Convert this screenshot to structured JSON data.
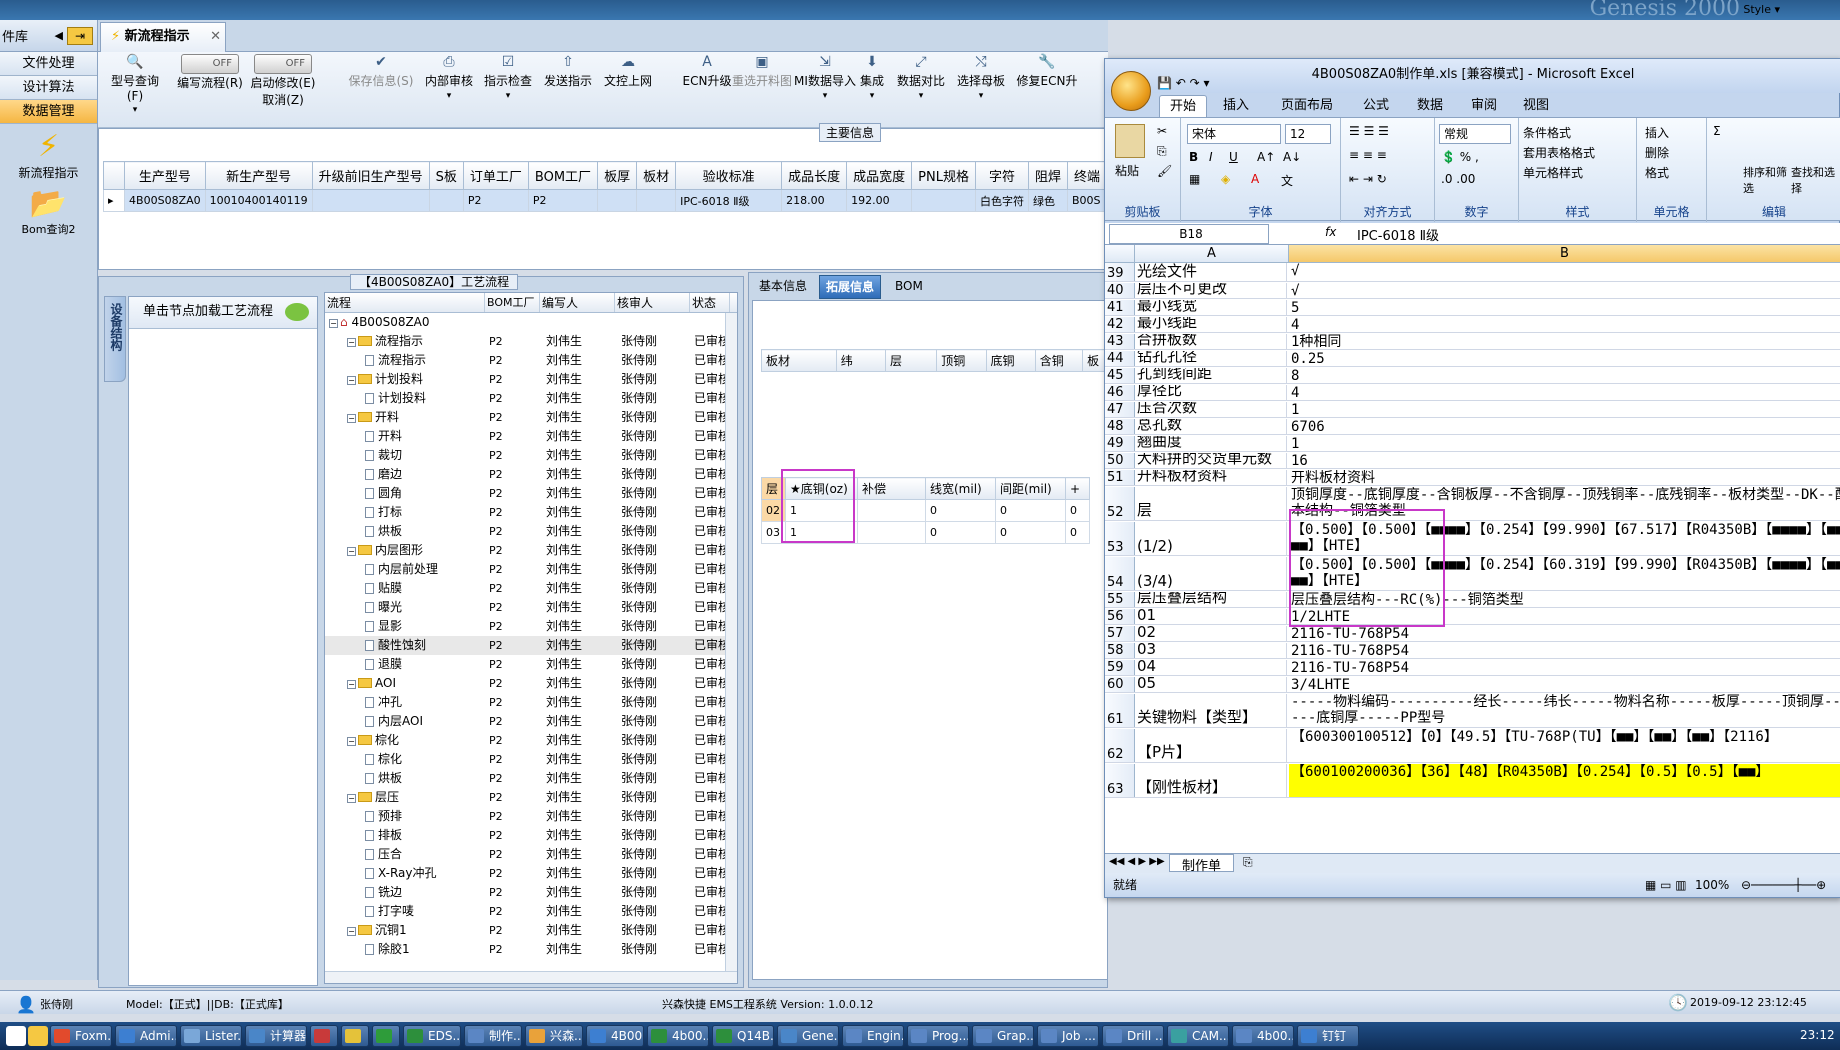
{
  "topbar": {
    "style_label": "Style ▾",
    "bg_text": "Genesis 2000"
  },
  "leftnav": {
    "title": "件库",
    "items": [
      "文件处理",
      "设计算法",
      "数据管理"
    ],
    "apps": [
      "新流程指示",
      "Bom查询2"
    ]
  },
  "tab": {
    "label": "新流程指示"
  },
  "ribbon": {
    "buttons": [
      {
        "label": "型号查询(F)",
        "icon": "search-icon"
      },
      {
        "label": "编写流程(R)",
        "icon": "toggle-off",
        "toggle": "OFF"
      },
      {
        "label": "启动修改(E)",
        "sub": "取消(Z)",
        "icon": "toggle-off",
        "toggle": "OFF"
      },
      {
        "label": "保存信息(S)",
        "icon": "check-icon",
        "disabled": true
      },
      {
        "label": "内部审核",
        "icon": "print-icon"
      },
      {
        "label": "指示检查",
        "icon": "check-icon"
      },
      {
        "label": "发送指示",
        "icon": "upload-icon"
      },
      {
        "label": "文控上网",
        "icon": "cloud-icon"
      },
      {
        "label": "ECN升级",
        "icon": "ecn-icon"
      },
      {
        "label": "重选开料图",
        "icon": "image-icon",
        "disabled": true
      },
      {
        "label": "MI数据导入",
        "icon": "import-icon"
      },
      {
        "label": "集成",
        "icon": "download-icon"
      },
      {
        "label": "数据对比",
        "icon": "compare-icon"
      },
      {
        "label": "选择母板",
        "icon": "shuffle-icon"
      },
      {
        "label": "修复ECN升",
        "icon": "wrench-icon"
      }
    ]
  },
  "maininfo": {
    "caption": "主要信息",
    "headers": [
      "生产型号",
      "新生产型号",
      "升级前旧生产型号",
      "S板",
      "订单工厂",
      "BOM工厂",
      "板厚",
      "板材",
      "验收标准",
      "成品长度",
      "成品宽度",
      "PNL规格",
      "字符",
      "阻焊",
      "终端"
    ],
    "row": [
      "4B00S08ZA0",
      "10010400140119",
      "",
      "",
      "P2",
      "P2",
      "",
      "",
      "IPC-6018 Ⅱ级",
      "218.00",
      "192.00",
      "",
      "白色字符",
      "绿色",
      "B00S"
    ]
  },
  "process": {
    "caption": "【4B00S08ZA0】工艺流程",
    "sidetab": "设备结构",
    "node_hint": "单击节点加载工艺流程",
    "headers": [
      "流程",
      "BOM工厂",
      "编写人",
      "核审人",
      "状态"
    ],
    "rows": [
      {
        "lvl": 0,
        "type": "root",
        "name": "4B00S08ZA0",
        "f": "",
        "w": "",
        "c": "",
        "s": ""
      },
      {
        "lvl": 1,
        "type": "folder",
        "name": "流程指示",
        "f": "P2",
        "w": "刘伟生",
        "c": "张侍刚",
        "s": "已审核"
      },
      {
        "lvl": 2,
        "type": "doc",
        "name": "流程指示",
        "f": "P2",
        "w": "刘伟生",
        "c": "张侍刚",
        "s": "已审核"
      },
      {
        "lvl": 1,
        "type": "folder",
        "name": "计划投料",
        "f": "P2",
        "w": "刘伟生",
        "c": "张侍刚",
        "s": "已审核"
      },
      {
        "lvl": 2,
        "type": "doc",
        "name": "计划投料",
        "f": "P2",
        "w": "刘伟生",
        "c": "张侍刚",
        "s": "已审核"
      },
      {
        "lvl": 1,
        "type": "folder",
        "name": "开料",
        "f": "P2",
        "w": "刘伟生",
        "c": "张侍刚",
        "s": "已审核"
      },
      {
        "lvl": 2,
        "type": "doc",
        "name": "开料",
        "f": "P2",
        "w": "刘伟生",
        "c": "张侍刚",
        "s": "已审核"
      },
      {
        "lvl": 2,
        "type": "doc",
        "name": "裁切",
        "f": "P2",
        "w": "刘伟生",
        "c": "张侍刚",
        "s": "已审核"
      },
      {
        "lvl": 2,
        "type": "doc",
        "name": "磨边",
        "f": "P2",
        "w": "刘伟生",
        "c": "张侍刚",
        "s": "已审核"
      },
      {
        "lvl": 2,
        "type": "doc",
        "name": "圆角",
        "f": "P2",
        "w": "刘伟生",
        "c": "张侍刚",
        "s": "已审核"
      },
      {
        "lvl": 2,
        "type": "doc",
        "name": "打标",
        "f": "P2",
        "w": "刘伟生",
        "c": "张侍刚",
        "s": "已审核"
      },
      {
        "lvl": 2,
        "type": "doc",
        "name": "烘板",
        "f": "P2",
        "w": "刘伟生",
        "c": "张侍刚",
        "s": "已审核"
      },
      {
        "lvl": 1,
        "type": "folder",
        "name": "内层图形",
        "f": "P2",
        "w": "刘伟生",
        "c": "张侍刚",
        "s": "已审核"
      },
      {
        "lvl": 2,
        "type": "doc",
        "name": "内层前处理",
        "f": "P2",
        "w": "刘伟生",
        "c": "张侍刚",
        "s": "已审核"
      },
      {
        "lvl": 2,
        "type": "doc",
        "name": "贴膜",
        "f": "P2",
        "w": "刘伟生",
        "c": "张侍刚",
        "s": "已审核"
      },
      {
        "lvl": 2,
        "type": "doc",
        "name": "曝光",
        "f": "P2",
        "w": "刘伟生",
        "c": "张侍刚",
        "s": "已审核"
      },
      {
        "lvl": 2,
        "type": "doc",
        "name": "显影",
        "f": "P2",
        "w": "刘伟生",
        "c": "张侍刚",
        "s": "已审核"
      },
      {
        "lvl": 2,
        "type": "doc",
        "name": "酸性蚀刻",
        "f": "P2",
        "w": "刘伟生",
        "c": "张侍刚",
        "s": "已审核",
        "sel": true
      },
      {
        "lvl": 2,
        "type": "doc",
        "name": "退膜",
        "f": "P2",
        "w": "刘伟生",
        "c": "张侍刚",
        "s": "已审核"
      },
      {
        "lvl": 1,
        "type": "folder",
        "name": "AOI",
        "f": "P2",
        "w": "刘伟生",
        "c": "张侍刚",
        "s": "已审核"
      },
      {
        "lvl": 2,
        "type": "doc",
        "name": "冲孔",
        "f": "P2",
        "w": "刘伟生",
        "c": "张侍刚",
        "s": "已审核"
      },
      {
        "lvl": 2,
        "type": "doc",
        "name": "内层AOI",
        "f": "P2",
        "w": "刘伟生",
        "c": "张侍刚",
        "s": "已审核"
      },
      {
        "lvl": 1,
        "type": "folder",
        "name": "棕化",
        "f": "P2",
        "w": "刘伟生",
        "c": "张侍刚",
        "s": "已审核"
      },
      {
        "lvl": 2,
        "type": "doc",
        "name": "棕化",
        "f": "P2",
        "w": "刘伟生",
        "c": "张侍刚",
        "s": "已审核"
      },
      {
        "lvl": 2,
        "type": "doc",
        "name": "烘板",
        "f": "P2",
        "w": "刘伟生",
        "c": "张侍刚",
        "s": "已审核"
      },
      {
        "lvl": 1,
        "type": "folder",
        "name": "层压",
        "f": "P2",
        "w": "刘伟生",
        "c": "张侍刚",
        "s": "已审核"
      },
      {
        "lvl": 2,
        "type": "doc",
        "name": "预排",
        "f": "P2",
        "w": "刘伟生",
        "c": "张侍刚",
        "s": "已审核"
      },
      {
        "lvl": 2,
        "type": "doc",
        "name": "排板",
        "f": "P2",
        "w": "刘伟生",
        "c": "张侍刚",
        "s": "已审核"
      },
      {
        "lvl": 2,
        "type": "doc",
        "name": "压合",
        "f": "P2",
        "w": "刘伟生",
        "c": "张侍刚",
        "s": "已审核"
      },
      {
        "lvl": 2,
        "type": "doc",
        "name": "X-Ray冲孔",
        "f": "P2",
        "w": "刘伟生",
        "c": "张侍刚",
        "s": "已审核"
      },
      {
        "lvl": 2,
        "type": "doc",
        "name": "铣边",
        "f": "P2",
        "w": "刘伟生",
        "c": "张侍刚",
        "s": "已审核"
      },
      {
        "lvl": 2,
        "type": "doc",
        "name": "打字唛",
        "f": "P2",
        "w": "刘伟生",
        "c": "张侍刚",
        "s": "已审核"
      },
      {
        "lvl": 1,
        "type": "folder",
        "name": "沉铜1",
        "f": "P2",
        "w": "刘伟生",
        "c": "张侍刚",
        "s": "已审核"
      },
      {
        "lvl": 2,
        "type": "doc",
        "name": "除胶1",
        "f": "P2",
        "w": "刘伟生",
        "c": "张侍刚",
        "s": "已审核"
      }
    ]
  },
  "detail": {
    "tabs": [
      "基本信息",
      "拓展信息",
      "BOM"
    ],
    "grid1_headers": [
      "板材",
      "纬",
      "层",
      "顶铜",
      "底铜",
      "含铜",
      "板"
    ],
    "grid2_headers": [
      "层",
      "★底铜(oz)",
      "补偿",
      "线宽(mil)",
      "间距(mil)",
      "+"
    ],
    "grid2_rows": [
      [
        "02",
        "1",
        "",
        "0",
        "0",
        "0"
      ],
      [
        "03",
        "1",
        "",
        "0",
        "0",
        "0"
      ]
    ]
  },
  "status": {
    "user": "张侍刚",
    "model": "Model:【正式】||DB:【正式库】",
    "system": "兴森快捷 EMS工程系统 Version: 1.0.0.12",
    "datetime": "2019-09-12 23:12:45"
  },
  "taskbar": {
    "items": [
      "Foxm...",
      "Admi...",
      "Lister...",
      "计算器",
      "",
      "",
      "",
      "EDS...",
      "制作...",
      "兴森...",
      "4B00...",
      "4b00...",
      "Q14B...",
      "Gene...",
      "Engin...",
      "Prog...",
      "Grap...",
      "Job ...",
      "Drill ...",
      "CAM...",
      "4b00...",
      "钉钉"
    ],
    "clock": "23:12"
  },
  "excel": {
    "title": "4B00S08ZA0制作单.xls  [兼容模式] - Microsoft Excel",
    "tabs": [
      "开始",
      "插入",
      "页面布局",
      "公式",
      "数据",
      "审阅",
      "视图"
    ],
    "font": "宋体",
    "size": "12",
    "numfmt": "常规",
    "groups": [
      "剪贴板",
      "字体",
      "对齐方式",
      "数字",
      "样式",
      "单元格",
      "编辑"
    ],
    "paste": "粘贴",
    "styles": [
      "条件格式",
      "套用表格格式",
      "单元格样式"
    ],
    "cells": [
      "插入",
      "删除",
      "格式"
    ],
    "edit": [
      "排序和筛选",
      "查找和选择"
    ],
    "cellref": "B18",
    "formula": "IPC-6018 Ⅱ级",
    "colA": "A",
    "colB": "B",
    "rows": [
      {
        "n": "39",
        "a": "光绘文件",
        "b": "√",
        "h": 19
      },
      {
        "n": "40",
        "a": "层压不可更改",
        "b": "√",
        "h": 16
      },
      {
        "n": "41",
        "a": "最小线宽",
        "b": "5",
        "h": 16
      },
      {
        "n": "42",
        "a": "最小线距",
        "b": "4",
        "h": 16
      },
      {
        "n": "43",
        "a": "合拼板数",
        "b": "1种相同",
        "h": 16
      },
      {
        "n": "44",
        "a": "钻孔孔径",
        "b": "0.25",
        "h": 16
      },
      {
        "n": "45",
        "a": "孔到线间距",
        "b": "8",
        "h": 16
      },
      {
        "n": "46",
        "a": "厚径比",
        "b": "4",
        "h": 16
      },
      {
        "n": "47",
        "a": "压合次数",
        "b": "1",
        "h": 16
      },
      {
        "n": "48",
        "a": "总孔数",
        "b": "6706",
        "h": 16
      },
      {
        "n": "49",
        "a": "翘曲度",
        "b": "1",
        "h": 16
      },
      {
        "n": "50",
        "a": "大料拼的交货单元数",
        "b": "16",
        "h": 16
      },
      {
        "n": "51",
        "a": "开料板材资料",
        "b": "开料板材资料",
        "h": 16
      },
      {
        "n": "52",
        "a": "层",
        "b": "顶铜厚度--底铜厚度--含铜板厚--不含铜厚--顶残铜率--底残铜率--板材类型--DK--配本结构--铜箔类型",
        "h": 34
      },
      {
        "n": "53",
        "a": "(1/2)",
        "b": "【0.500】【0.500】【■■■■】【0.254】【99.990】【67.517】【R04350B】【■■■■】【■■■■】【HTE】",
        "h": 34
      },
      {
        "n": "54",
        "a": "(3/4)",
        "b": "【0.500】【0.500】【■■■■】【0.254】【60.319】【99.990】【R04350B】【■■■■】【■■■■】【HTE】",
        "h": 34
      },
      {
        "n": "55",
        "a": "层压叠层结构",
        "b": "层压叠层结构---RC(%)---铜箔类型",
        "h": 16
      },
      {
        "n": "56",
        "a": "01",
        "b": "1/2LHTE",
        "h": 16
      },
      {
        "n": "57",
        "a": "02",
        "b": "2116-TU-768P54",
        "h": 16
      },
      {
        "n": "58",
        "a": "03",
        "b": "2116-TU-768P54",
        "h": 16
      },
      {
        "n": "59",
        "a": "04",
        "b": "2116-TU-768P54",
        "h": 16
      },
      {
        "n": "60",
        "a": "05",
        "b": "3/4LHTE",
        "h": 16
      },
      {
        "n": "61",
        "a": "关键物料【类型】",
        "b": "-----物料编码----------经长-----纬长-----物料名称-----板厚-----顶铜厚-----底铜厚-----PP型号",
        "h": 34
      },
      {
        "n": "62",
        "a": "【P片】",
        "b": "【600300100512】【0】【49.5】【TU-768P(TU】【■■】【■■】【■■】【2116】",
        "h": 34
      },
      {
        "n": "63",
        "a": "【刚性板材】",
        "b": "【600100200036】【36】【48】【R04350B】【0.254】【0.5】【0.5】【■■】",
        "h": 34,
        "yellow": true
      }
    ],
    "sheet_tab": "制作单",
    "status": "就绪",
    "zoom": "100%"
  }
}
